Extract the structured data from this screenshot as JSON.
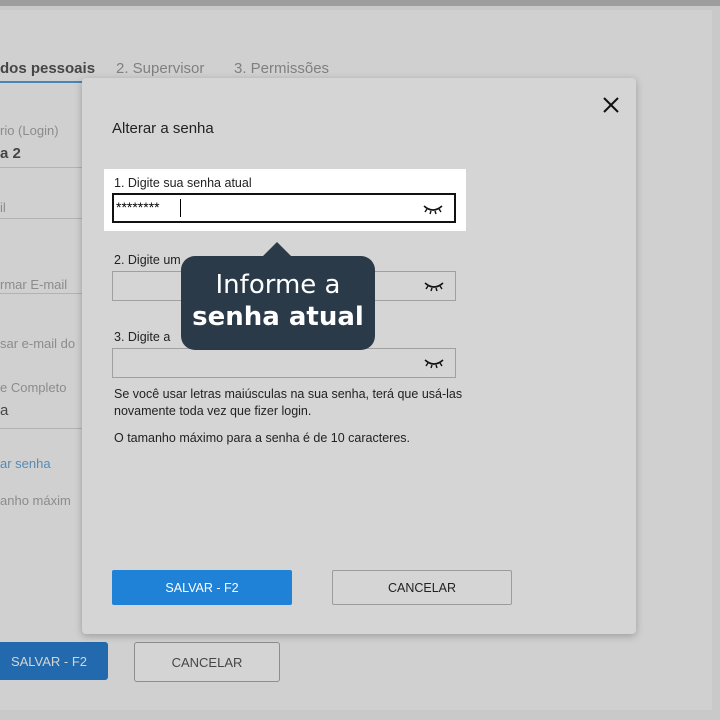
{
  "background": {
    "tabs": [
      "dos pessoais",
      "2. Supervisor",
      "3. Permissões"
    ],
    "fields": [
      {
        "label": "rio (Login)",
        "value": "a 2"
      },
      {
        "label": "il",
        "value": ""
      },
      {
        "label": "rmar E-mail",
        "value": ""
      },
      {
        "label": "sar e-mail do",
        "value": ""
      },
      {
        "label": "e Completo",
        "value": "a"
      }
    ],
    "link": "ar senha",
    "hint": "anho máxim",
    "save_label": "SALVAR - F2",
    "cancel_label": "CANCELAR"
  },
  "modal": {
    "title": "Alterar a senha",
    "fields": [
      {
        "label": "1. Digite sua senha atual",
        "value": "********"
      },
      {
        "label": "2. Digite um",
        "value": ""
      },
      {
        "label": "3. Digite a",
        "value": ""
      }
    ],
    "info1": "Se você usar letras maiúsculas na sua senha, terá que usá-las novamente toda vez que fizer login.",
    "info2": "O tamanho máximo para a senha é de 10 caracteres.",
    "save_label": "SALVAR - F2",
    "cancel_label": "CANCELAR"
  },
  "tooltip": {
    "line1": "Informe a",
    "line2": "senha atual"
  },
  "icons": {
    "close": "close-icon",
    "eye": "eye-closed-icon"
  },
  "colors": {
    "primary": "#1f82d6",
    "tooltip_bg": "#2b3a49"
  }
}
